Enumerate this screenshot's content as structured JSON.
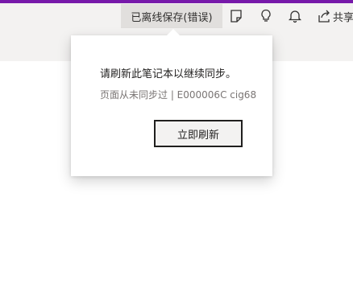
{
  "toolbar": {
    "sync_status": "已离线保存(错误)",
    "share_label": "共享",
    "icons": [
      "sticky-notes-icon",
      "lightbulb-icon",
      "bell-icon",
      "share-icon"
    ],
    "background": "#f3f2f1",
    "accent": "#7719aa"
  },
  "popup": {
    "title": "请刷新此笔记本以继续同步。",
    "subtitle": "页面从未同步过 | E000006C cig68",
    "button_label": "立即刷新"
  }
}
